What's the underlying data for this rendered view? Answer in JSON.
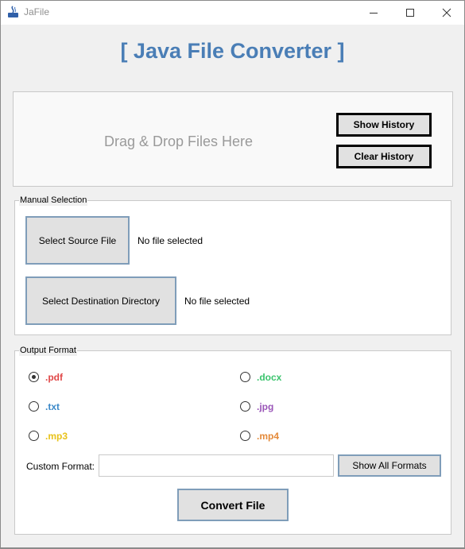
{
  "window": {
    "title": "JaFile",
    "controls": {
      "minimize": "minimize",
      "maximize": "maximize",
      "close": "close"
    }
  },
  "header": {
    "title": "[ Java File Converter ]"
  },
  "drop_zone": {
    "text": "Drag & Drop Files Here",
    "show_history_label": "Show History",
    "clear_history_label": "Clear History"
  },
  "manual_selection": {
    "legend": "Manual Selection",
    "source_button": "Select Source File",
    "source_status": "No file selected",
    "destination_button": "Select Destination Directory",
    "destination_status": "No file selected"
  },
  "output_format": {
    "legend": "Output Format",
    "options": [
      {
        "label": ".pdf",
        "color": "#e04848",
        "selected": true
      },
      {
        "label": ".docx",
        "color": "#3cc46e",
        "selected": false
      },
      {
        "label": ".txt",
        "color": "#3a88c8",
        "selected": false
      },
      {
        "label": ".jpg",
        "color": "#9a55b8",
        "selected": false
      },
      {
        "label": ".mp3",
        "color": "#e8c21a",
        "selected": false
      },
      {
        "label": ".mp4",
        "color": "#e48a3a",
        "selected": false
      }
    ],
    "custom_label": "Custom Format:",
    "custom_value": "",
    "custom_placeholder": "",
    "show_all_label": "Show All Formats",
    "convert_label": "Convert File"
  },
  "colors": {
    "heading": "#4a7eb6",
    "window_bg": "#f0f0f0",
    "button_bg": "#e1e1e1",
    "button_border": "#7f9db9"
  }
}
